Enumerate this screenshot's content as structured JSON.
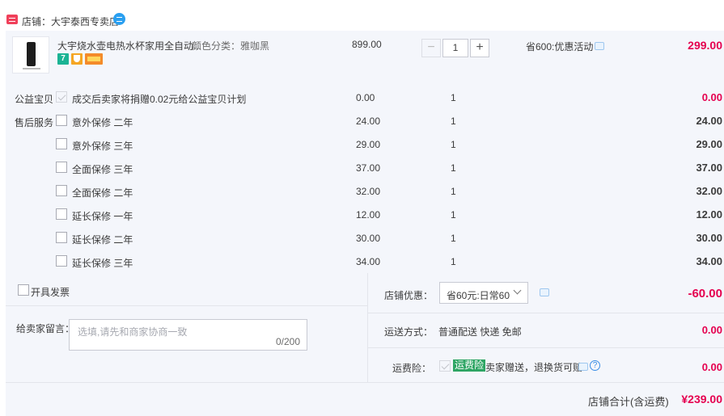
{
  "shop": {
    "name": "店铺：大宇泰西专卖店"
  },
  "item": {
    "title": "大宇烧水壶电热水杯家用全自动...",
    "variant": "颜色分类：雅咖黑",
    "badge_seven": "7",
    "price": "899.00",
    "qty_minus": "−",
    "quantity": "1",
    "qty_plus": "+",
    "promo": "省600:优惠活动",
    "total": "299.00"
  },
  "services": [
    {
      "category": "公益宝贝",
      "name": "成交后卖家将捐赠0.02元给公益宝贝计划",
      "price": "0.00",
      "qty": "1",
      "total": "0.00",
      "checked_disabled": true
    },
    {
      "category": "售后服务",
      "name": "意外保修 二年",
      "price": "24.00",
      "qty": "1",
      "total": "24.00"
    },
    {
      "category": "",
      "name": "意外保修 三年",
      "price": "29.00",
      "qty": "1",
      "total": "29.00"
    },
    {
      "category": "",
      "name": "全面保修 三年",
      "price": "37.00",
      "qty": "1",
      "total": "37.00"
    },
    {
      "category": "",
      "name": "全面保修 二年",
      "price": "32.00",
      "qty": "1",
      "total": "32.00"
    },
    {
      "category": "",
      "name": "延长保修 一年",
      "price": "12.00",
      "qty": "1",
      "total": "12.00"
    },
    {
      "category": "",
      "name": "延长保修 二年",
      "price": "30.00",
      "qty": "1",
      "total": "30.00"
    },
    {
      "category": "",
      "name": "延长保修 三年",
      "price": "34.00",
      "qty": "1",
      "total": "34.00"
    }
  ],
  "invoice": {
    "label": "开具发票"
  },
  "memo": {
    "label": "给卖家留言：",
    "placeholder": "选填,请先和商家协商一致",
    "count": "0/200"
  },
  "discount": {
    "label": "店铺优惠：",
    "selected": "省60元:日常60",
    "amount": "-60.00"
  },
  "shipping": {
    "label": "运送方式：",
    "value": "普通配送 快递 免邮",
    "amount": "0.00"
  },
  "insurance": {
    "label": "运费险：",
    "tag": "运费险",
    "desc": "卖家赠送，退换货可赔",
    "help": "?",
    "amount": "0.00"
  },
  "summary": {
    "label": "店铺合计(含运费)",
    "amount": "¥239.00"
  },
  "colors": {
    "accent_red": "#e5004f",
    "panel_bg": "#f4f6fb",
    "insurance_green": "#2ea564",
    "shop_icon": "#f0405a",
    "chat_blue": "#2a9ff0"
  }
}
